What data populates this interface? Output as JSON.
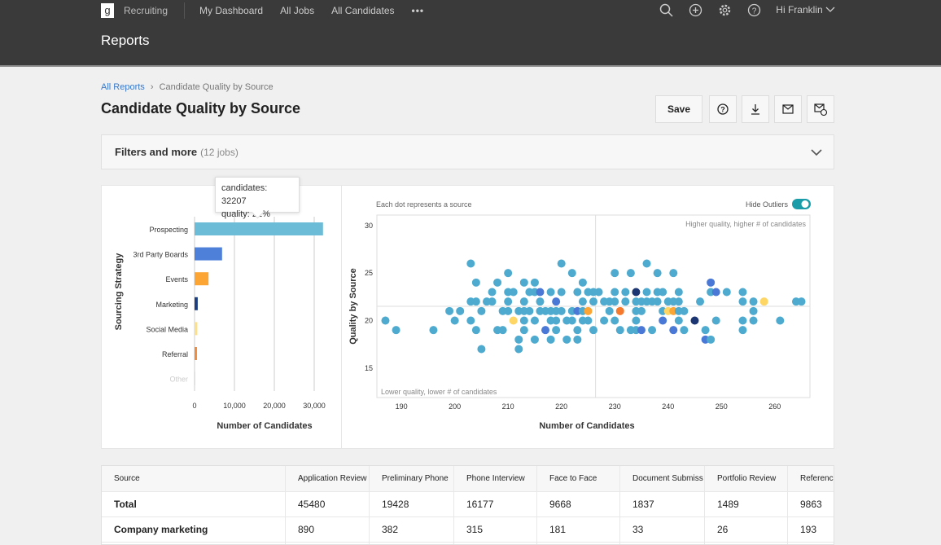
{
  "topnav": {
    "logo": "g",
    "app": "Recruiting",
    "links": [
      "My Dashboard",
      "All Jobs",
      "All Candidates"
    ],
    "more": "•••",
    "user": "Hi Franklin"
  },
  "header": {
    "title": "Reports"
  },
  "breadcrumb": {
    "root": "All Reports",
    "sep": "›",
    "current": "Candidate Quality by Source"
  },
  "page_title": "Candidate Quality by Source",
  "actions": {
    "save": "Save"
  },
  "filters": {
    "label": "Filters and more",
    "count": "(12 jobs)"
  },
  "chart_data": [
    {
      "type": "bar",
      "orientation": "horizontal",
      "ylabel": "Sourcing Strategy",
      "xlabel": "Number of Candidates",
      "xlim": [
        0,
        32207
      ],
      "xticks": [
        "0",
        "10,000",
        "20,000",
        "30,000"
      ],
      "grid": true,
      "categories": [
        "Prospecting",
        "3rd Party Boards",
        "Events",
        "Marketing",
        "Social Media",
        "Referral",
        "Other"
      ],
      "values": [
        32207,
        6900,
        3500,
        800,
        700,
        600,
        50
      ],
      "colors": [
        "#6cbcd8",
        "#4e80da",
        "#fca434",
        "#1d3f7f",
        "#fde08a",
        "#f08a3c",
        "#dddddd"
      ],
      "tooltip": {
        "line1": "candidates: 32207",
        "line2": "quality: 21%"
      }
    },
    {
      "type": "scatter",
      "note": "Each dot represents a source",
      "toggle_label": "Hide Outliers",
      "toggle_on": true,
      "xlabel": "Number of Candidates",
      "ylabel": "Quality by Source",
      "xlim": [
        185.4,
        266.6
      ],
      "ylim": [
        11.9,
        31.1
      ],
      "xticks": [
        "190",
        "200",
        "210",
        "220",
        "230",
        "240",
        "250",
        "260"
      ],
      "yticks": [
        "15",
        "20",
        "25",
        "30"
      ],
      "quadrant_lines": {
        "x": 226.4,
        "y": 21.5
      },
      "quadrant_top_right": "Higher quality, higher # of candidates",
      "quadrant_bottom_left": "Lower quality, lower # of candidates",
      "colors": {
        "a": "#4eabcf",
        "b": "#4a78d6",
        "d": "#1b3672",
        "y": "#fdd665",
        "o": "#fca434",
        "r": "#f57a2e"
      },
      "points": [
        [
          203,
          26,
          "a"
        ],
        [
          220,
          26,
          "a"
        ],
        [
          236,
          26,
          "a"
        ],
        [
          210,
          25,
          "a"
        ],
        [
          222,
          25,
          "a"
        ],
        [
          230,
          25,
          "a"
        ],
        [
          233,
          25,
          "a"
        ],
        [
          238,
          25,
          "a"
        ],
        [
          241,
          25,
          "a"
        ],
        [
          204,
          24,
          "a"
        ],
        [
          208,
          24,
          "a"
        ],
        [
          213,
          24,
          "a"
        ],
        [
          215,
          24,
          "a"
        ],
        [
          224,
          24,
          "a"
        ],
        [
          248,
          24,
          "b"
        ],
        [
          207,
          23,
          "a"
        ],
        [
          210,
          23,
          "a"
        ],
        [
          211,
          23,
          "a"
        ],
        [
          214,
          23,
          "a"
        ],
        [
          215,
          23,
          "a"
        ],
        [
          216,
          23,
          "b"
        ],
        [
          218,
          23,
          "a"
        ],
        [
          220,
          23,
          "a"
        ],
        [
          223,
          23,
          "a"
        ],
        [
          225,
          23,
          "a"
        ],
        [
          226,
          23,
          "a"
        ],
        [
          227,
          23,
          "a"
        ],
        [
          230,
          23,
          "a"
        ],
        [
          232,
          23,
          "a"
        ],
        [
          234,
          23,
          "d"
        ],
        [
          236,
          23,
          "a"
        ],
        [
          238,
          23,
          "a"
        ],
        [
          239,
          23,
          "a"
        ],
        [
          242,
          23,
          "a"
        ],
        [
          248,
          23,
          "a"
        ],
        [
          249,
          23,
          "b"
        ],
        [
          251,
          23,
          "a"
        ],
        [
          254,
          23,
          "a"
        ],
        [
          203,
          22,
          "a"
        ],
        [
          204,
          22,
          "a"
        ],
        [
          206,
          22,
          "a"
        ],
        [
          207,
          22,
          "a"
        ],
        [
          210,
          22,
          "a"
        ],
        [
          213,
          22,
          "a"
        ],
        [
          216,
          22,
          "a"
        ],
        [
          219,
          22,
          "b"
        ],
        [
          224,
          22,
          "a"
        ],
        [
          226,
          22,
          "a"
        ],
        [
          228,
          22,
          "a"
        ],
        [
          229,
          22,
          "a"
        ],
        [
          230,
          22,
          "a"
        ],
        [
          232,
          22,
          "a"
        ],
        [
          234,
          22,
          "a"
        ],
        [
          235,
          22,
          "a"
        ],
        [
          236,
          22,
          "a"
        ],
        [
          237,
          22,
          "a"
        ],
        [
          238,
          22,
          "a"
        ],
        [
          240,
          22,
          "a"
        ],
        [
          241,
          22,
          "a"
        ],
        [
          242,
          22,
          "a"
        ],
        [
          246,
          22,
          "a"
        ],
        [
          254,
          22,
          "a"
        ],
        [
          256,
          22,
          "a"
        ],
        [
          258,
          22,
          "y"
        ],
        [
          264,
          22,
          "a"
        ],
        [
          265,
          22,
          "a"
        ],
        [
          199,
          21,
          "a"
        ],
        [
          201,
          21,
          "a"
        ],
        [
          205,
          21,
          "a"
        ],
        [
          209,
          21,
          "a"
        ],
        [
          210,
          21,
          "a"
        ],
        [
          212,
          21,
          "a"
        ],
        [
          213,
          21,
          "a"
        ],
        [
          214,
          21,
          "a"
        ],
        [
          216,
          21,
          "a"
        ],
        [
          217,
          21,
          "a"
        ],
        [
          218,
          21,
          "a"
        ],
        [
          219,
          21,
          "a"
        ],
        [
          220,
          21,
          "a"
        ],
        [
          222,
          21,
          "a"
        ],
        [
          223,
          21,
          "b"
        ],
        [
          224,
          21,
          "a"
        ],
        [
          225,
          21,
          "o"
        ],
        [
          229,
          21,
          "a"
        ],
        [
          231,
          21,
          "r"
        ],
        [
          234,
          21,
          "a"
        ],
        [
          235,
          21,
          "a"
        ],
        [
          239,
          21,
          "a"
        ],
        [
          240,
          21,
          "y"
        ],
        [
          241,
          21,
          "o"
        ],
        [
          242,
          21,
          "a"
        ],
        [
          243,
          21,
          "a"
        ],
        [
          256,
          21,
          "a"
        ],
        [
          187,
          20,
          "a"
        ],
        [
          200,
          20,
          "a"
        ],
        [
          203,
          20,
          "a"
        ],
        [
          211,
          20,
          "y"
        ],
        [
          213,
          20,
          "a"
        ],
        [
          215,
          20,
          "a"
        ],
        [
          218,
          20,
          "a"
        ],
        [
          219,
          20,
          "a"
        ],
        [
          221,
          20,
          "a"
        ],
        [
          222,
          20,
          "a"
        ],
        [
          224,
          20,
          "a"
        ],
        [
          225,
          20,
          "a"
        ],
        [
          228,
          20,
          "a"
        ],
        [
          230,
          20,
          "a"
        ],
        [
          234,
          20,
          "a"
        ],
        [
          239,
          20,
          "b"
        ],
        [
          242,
          20,
          "a"
        ],
        [
          245,
          20,
          "d"
        ],
        [
          249,
          20,
          "a"
        ],
        [
          254,
          20,
          "a"
        ],
        [
          256,
          20,
          "a"
        ],
        [
          261,
          20,
          "a"
        ],
        [
          189,
          19,
          "a"
        ],
        [
          196,
          19,
          "a"
        ],
        [
          204,
          19,
          "a"
        ],
        [
          208,
          19,
          "a"
        ],
        [
          209,
          19,
          "a"
        ],
        [
          213,
          19,
          "a"
        ],
        [
          217,
          19,
          "b"
        ],
        [
          219,
          19,
          "a"
        ],
        [
          223,
          19,
          "a"
        ],
        [
          226,
          19,
          "a"
        ],
        [
          231,
          19,
          "a"
        ],
        [
          233,
          19,
          "a"
        ],
        [
          234,
          19,
          "a"
        ],
        [
          235,
          19,
          "b"
        ],
        [
          237,
          19,
          "a"
        ],
        [
          241,
          19,
          "b"
        ],
        [
          243,
          19,
          "a"
        ],
        [
          247,
          19,
          "a"
        ],
        [
          254,
          19,
          "a"
        ],
        [
          212,
          18,
          "a"
        ],
        [
          215,
          18,
          "a"
        ],
        [
          218,
          18,
          "a"
        ],
        [
          221,
          18,
          "a"
        ],
        [
          223,
          18,
          "a"
        ],
        [
          247,
          18,
          "b"
        ],
        [
          248,
          18,
          "a"
        ],
        [
          205,
          17,
          "a"
        ],
        [
          212,
          17,
          "a"
        ]
      ]
    }
  ],
  "table": {
    "headers": [
      "Source",
      "Application Review",
      "Preliminary Phone",
      "Phone Interview",
      "Face to Face",
      "Document Submiss",
      "Portfolio Review",
      "Reference"
    ],
    "rows": [
      [
        "Total",
        "45480",
        "19428",
        "16177",
        "9668",
        "1837",
        "1489",
        "9863"
      ],
      [
        "Company marketing",
        "890",
        "382",
        "315",
        "181",
        "33",
        "26",
        "193"
      ],
      [
        "",
        "",
        "",
        "",
        "",
        "",
        "",
        ""
      ]
    ]
  }
}
